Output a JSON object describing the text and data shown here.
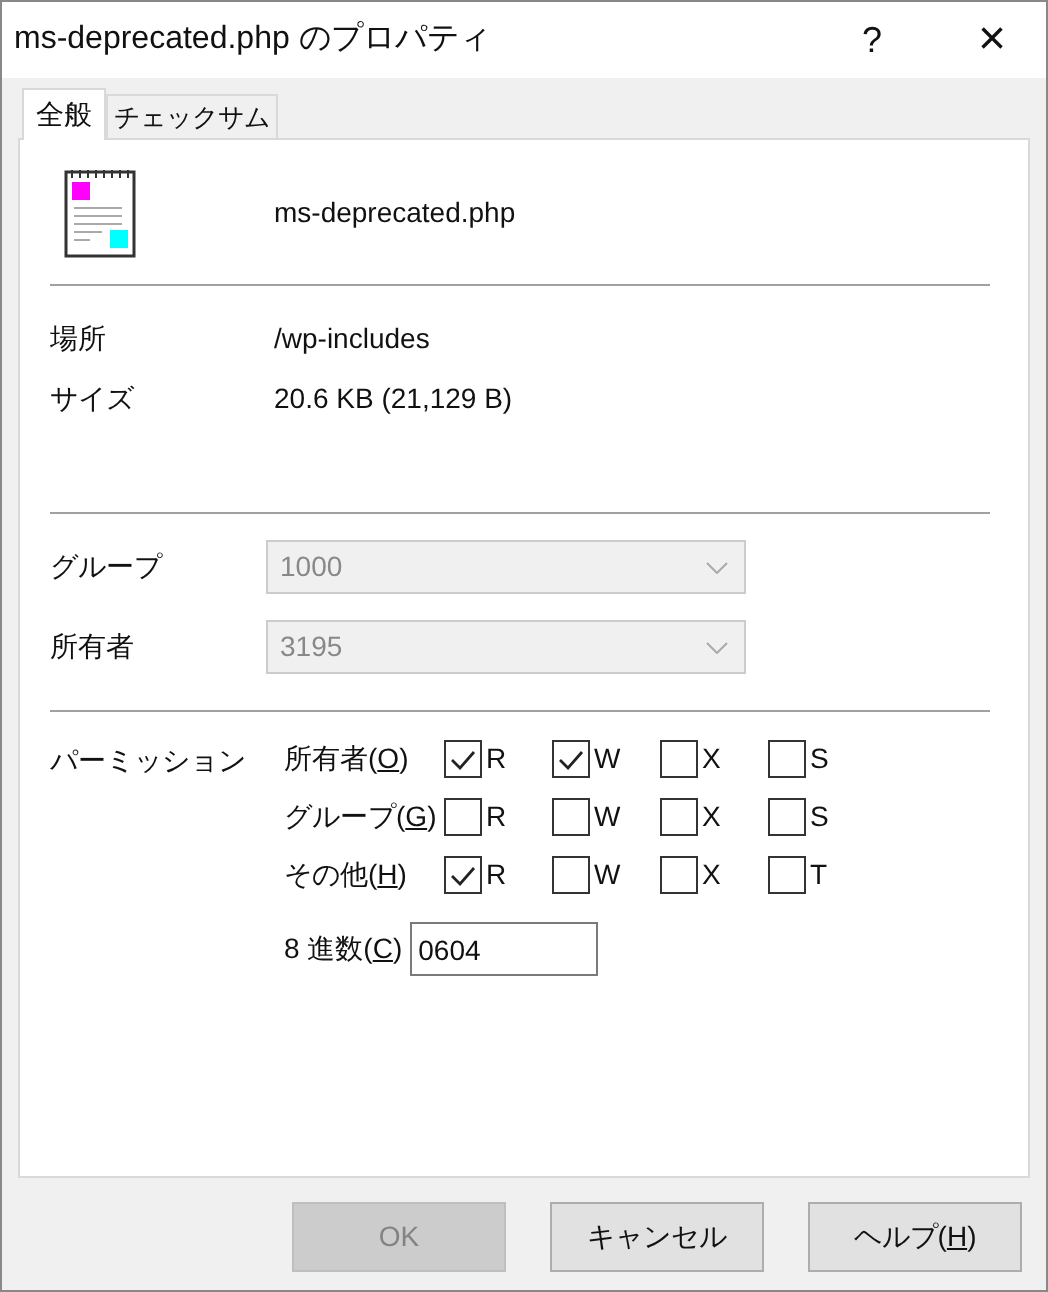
{
  "window": {
    "title": "ms-deprecated.php のプロパティ",
    "help_button": "?",
    "close_button": "×"
  },
  "tabs": [
    {
      "label": "全般",
      "selected": true
    },
    {
      "label": "チェックサム",
      "selected": false
    }
  ],
  "file": {
    "name": "ms-deprecated.php"
  },
  "info": [
    {
      "label": "場所",
      "value": "/wp-includes"
    },
    {
      "label": "サイズ",
      "value": "20.6 KB (21,129 B)"
    }
  ],
  "ownership": [
    {
      "label": "グループ",
      "value": "1000",
      "disabled": true
    },
    {
      "label": "所有者",
      "value": "3195",
      "disabled": true
    }
  ],
  "permissions": {
    "label": "パーミッション",
    "rows": [
      {
        "label": "所有者(",
        "access_key": "O",
        "label_end": ")",
        "bits": [
          {
            "label": "R",
            "checked": true
          },
          {
            "label": "W",
            "checked": true
          },
          {
            "label": "X",
            "checked": false
          },
          {
            "label": "S",
            "checked": false
          }
        ]
      },
      {
        "label": "グループ(",
        "access_key": "G",
        "label_end": ")",
        "bits": [
          {
            "label": "R",
            "checked": false
          },
          {
            "label": "W",
            "checked": false
          },
          {
            "label": "X",
            "checked": false
          },
          {
            "label": "S",
            "checked": false
          }
        ]
      },
      {
        "label": "その他(",
        "access_key": "H",
        "label_end": ")",
        "bits": [
          {
            "label": "R",
            "checked": true
          },
          {
            "label": "W",
            "checked": false
          },
          {
            "label": "X",
            "checked": false
          },
          {
            "label": "T",
            "checked": false
          }
        ]
      }
    ],
    "octal": {
      "label": "8 進数(",
      "access_key": "C",
      "label_end": ")",
      "value": "0604"
    }
  },
  "buttons": [
    {
      "label": "OK",
      "disabled": true
    },
    {
      "label": "キャンセル",
      "disabled": false
    },
    {
      "label": "ヘルプ(",
      "access_key": "H",
      "label_end": ")",
      "disabled": false
    }
  ]
}
